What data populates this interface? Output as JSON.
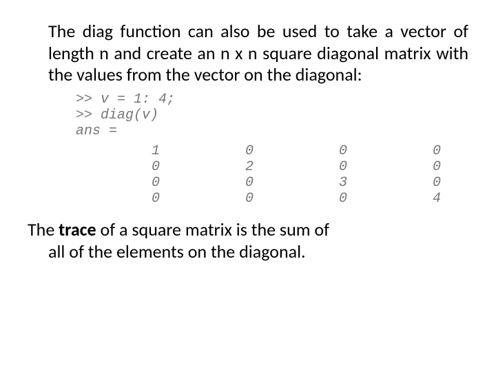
{
  "para1": "The diag function  can also be used to take a vector of length n and create an n  x  n  square diagonal  matrix  with  the  values  from   the vector  on   the diagonal:",
  "code": {
    "l1": ">> v = 1: 4;",
    "l2": ">> diag(v)",
    "l3": "ans ="
  },
  "matrix": [
    [
      "1",
      "0",
      "0",
      "0"
    ],
    [
      "0",
      "2",
      "0",
      "0"
    ],
    [
      "0",
      "0",
      "3",
      "0"
    ],
    [
      "0",
      "0",
      "0",
      "4"
    ]
  ],
  "para2": {
    "line1_pre": "The  ",
    "line1_bold": "trace",
    "line1_post": "  of  a  square  matrix  is  the  sum  of",
    "line2": "all  of  the  elements   on  the diagonal."
  }
}
